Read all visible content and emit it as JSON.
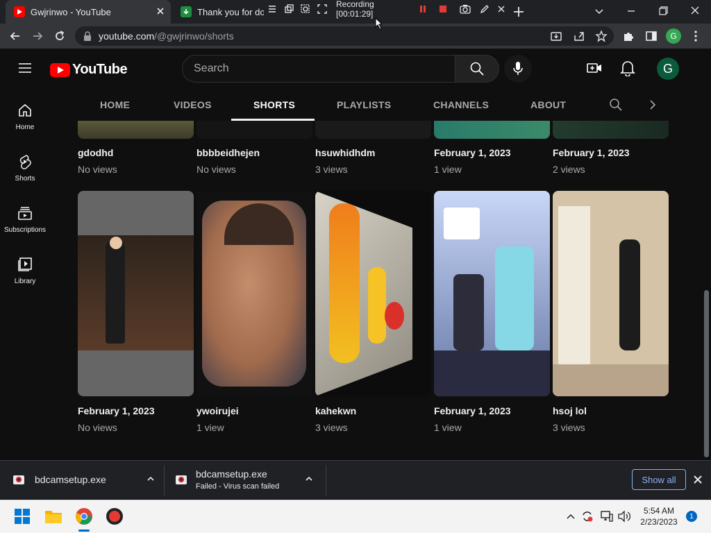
{
  "browser": {
    "tabs": [
      {
        "title": "Gwjrinwo - YouTube",
        "active": true
      },
      {
        "title": "Thank you for dow",
        "active": false
      }
    ],
    "recording_label": "Recording [00:01:29]",
    "url_host": "youtube.com",
    "url_path": "/@gwjrinwo/shorts",
    "profile_initial": "G"
  },
  "youtube": {
    "logo_text": "YouTube",
    "search_placeholder": "Search",
    "avatar_initial": "G",
    "sidebar": [
      {
        "label": "Home",
        "icon": "home-icon"
      },
      {
        "label": "Shorts",
        "icon": "shorts-icon"
      },
      {
        "label": "Subscriptions",
        "icon": "subscriptions-icon"
      },
      {
        "label": "Library",
        "icon": "library-icon"
      }
    ],
    "channel_tabs": [
      "HOME",
      "VIDEOS",
      "SHORTS",
      "PLAYLISTS",
      "CHANNELS",
      "ABOUT"
    ],
    "active_tab": "SHORTS",
    "top_row": [
      {
        "title": "gdodhd",
        "views": "No views"
      },
      {
        "title": "bbbbeidhejen",
        "views": "No views"
      },
      {
        "title": "hsuwhidhdm",
        "views": "3 views"
      },
      {
        "title": "February 1, 2023",
        "views": "1 view"
      },
      {
        "title": "February 1, 2023",
        "views": "2 views"
      }
    ],
    "bottom_row": [
      {
        "title": "February 1, 2023",
        "views": "No views"
      },
      {
        "title": "ywoirujei",
        "views": "1 view"
      },
      {
        "title": "kahekwn",
        "views": "3 views"
      },
      {
        "title": "February 1, 2023",
        "views": "1 view"
      },
      {
        "title": "hsoj lol",
        "views": "3 views"
      }
    ]
  },
  "downloads": {
    "items": [
      {
        "name": "bdcamsetup.exe",
        "status": ""
      },
      {
        "name": "bdcamsetup.exe",
        "status": "Failed - Virus scan failed"
      }
    ],
    "show_all": "Show all"
  },
  "taskbar": {
    "time": "5:54 AM",
    "date": "2/23/2023",
    "notification_count": "1"
  }
}
